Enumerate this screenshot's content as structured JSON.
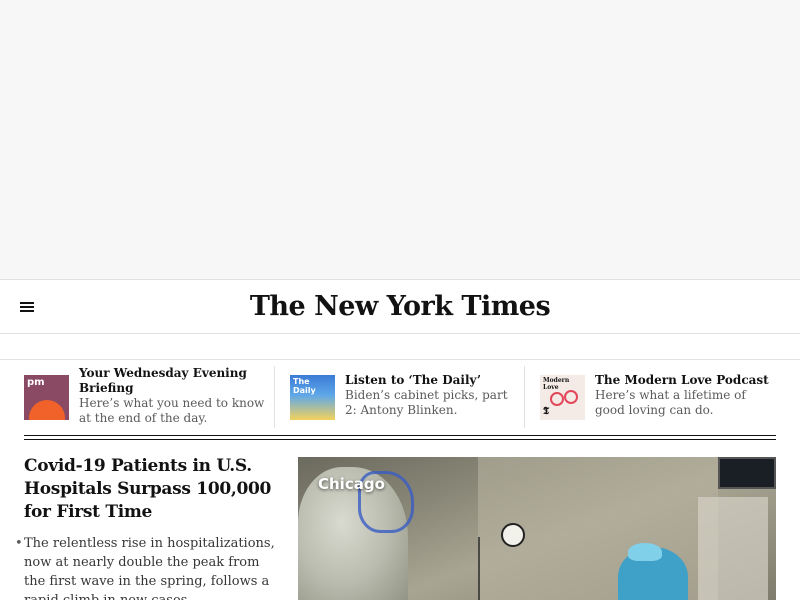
{
  "masthead": {
    "logo_text": "The New York Times",
    "menu_icon": "hamburger-menu-icon"
  },
  "briefings": [
    {
      "thumb_label": "pm",
      "title": "Your Wednesday Evening Briefing",
      "summary": "Here’s what you need to know at the end of the day."
    },
    {
      "thumb_label": "The Daily",
      "title": "Listen to ‘The Daily’",
      "summary": "Biden’s cabinet picks, part 2: Antony Blinken."
    },
    {
      "thumb_label": "Modern Love",
      "title": "The Modern Love Podcast",
      "summary": "Here’s what a lifetime of good loving can do."
    }
  ],
  "lead_story": {
    "headline": "Covid-19 Patients in U.S. Hospitals Surpass 100,000 for First Time",
    "summary": "The relentless rise in hospitalizations, now at nearly double the peak from the first wave in the spring, follows a rapid climb in new cases."
  },
  "lead_photo": {
    "caption": "Chicago"
  },
  "colors": {
    "ad_background": "#f7f7f7",
    "text_primary": "#121212",
    "text_secondary": "#5a5a5a",
    "divider": "#e2e2e2"
  }
}
